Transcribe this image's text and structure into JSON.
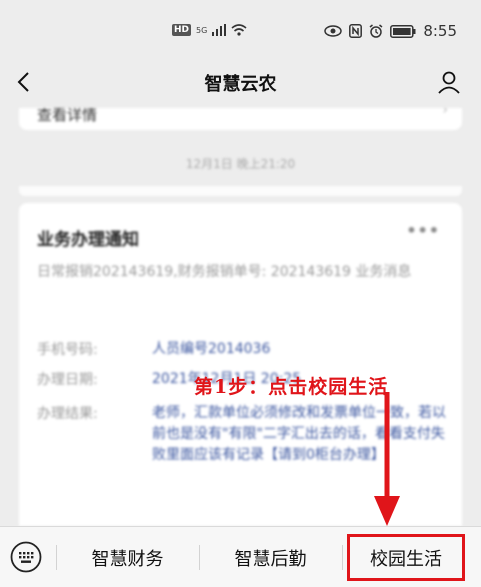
{
  "status_bar": {
    "hd_badge": "HD",
    "network": "5G",
    "time": "8:55"
  },
  "nav": {
    "title": "智慧云农"
  },
  "prev_card": {
    "link_text": "查看详情",
    "arrow": "›"
  },
  "timestamp": "12月1日 晚上21:20",
  "notice_card": {
    "title": "业务办理通知",
    "more": "•••",
    "description": "日常报销202143619,财务报销单号: 202143619 业务消息",
    "rows": [
      {
        "label": "手机号码:",
        "value": "人员编号2014036"
      },
      {
        "label": "办理日期:",
        "value": "2021年12月1日 20:25"
      },
      {
        "label": "办理结果:",
        "value": "老师，汇款单位必须修改和发票单位一致，若以前也是没有\"有限\"二字汇出去的话，看看支付失败里面应该有记录【请到0柜台办理】"
      }
    ]
  },
  "annotation": {
    "text": "第1步：点击校园生活",
    "color": "#e0151a"
  },
  "bottom_menu": {
    "tabs": [
      "智慧财务",
      "智慧后勤",
      "校园生活"
    ]
  }
}
